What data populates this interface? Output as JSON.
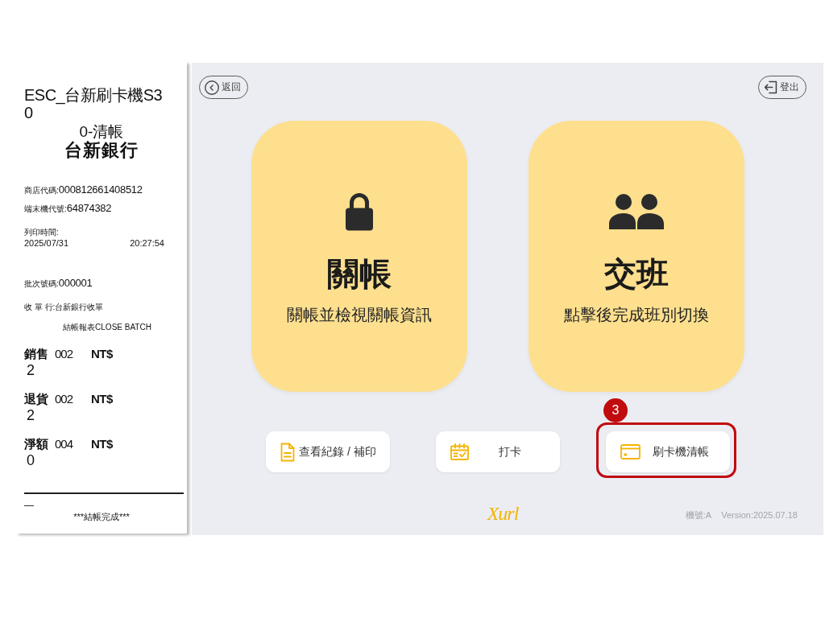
{
  "receipt": {
    "lines": [
      {
        "kind": "heading",
        "text": "ESC_台新刷卡機S3"
      },
      {
        "kind": "heading",
        "text": "0"
      },
      {
        "kind": "center",
        "text": "0-清帳"
      },
      {
        "kind": "bank",
        "text": "台新銀行"
      },
      {
        "kind": "field",
        "label": "商店代碼:",
        "value": "000812661408512"
      },
      {
        "kind": "field",
        "label": "端末機代號:",
        "value": "64874382"
      },
      {
        "kind": "note",
        "text": "列印時間:"
      },
      {
        "kind": "split",
        "left": "2025/07/31",
        "right": "20:27:54"
      },
      {
        "kind": "field",
        "label": "批次號碼:",
        "value": "000001"
      },
      {
        "kind": "note",
        "text": "收 單 行:台新銀行收單"
      },
      {
        "kind": "caption",
        "text": "結帳報表CLOSE BATCH"
      },
      {
        "kind": "total",
        "label": "銷售",
        "count": "002",
        "currency": "NT$",
        "amount": "2"
      },
      {
        "kind": "total",
        "label": "退貨",
        "count": "002",
        "currency": "NT$",
        "amount": "2"
      },
      {
        "kind": "total",
        "label": "淨額",
        "count": "004",
        "currency": "NT$",
        "amount": "0"
      },
      {
        "kind": "rule"
      },
      {
        "kind": "dash",
        "text": "—"
      },
      {
        "kind": "closing",
        "text": "***結帳完成***"
      }
    ]
  },
  "toolbar": {
    "back": {
      "label": "返回"
    },
    "logout": {
      "label": "登出"
    }
  },
  "cards": [
    {
      "kind": "lock",
      "title": "關帳",
      "subtitle": "關帳並檢視關帳資訊"
    },
    {
      "kind": "people",
      "title": "交班",
      "subtitle": "點擊後完成班別切換"
    }
  ],
  "actions": [
    {
      "kind": "document",
      "label": "查看紀錄 / 補印",
      "highlighted": false
    },
    {
      "kind": "calendar",
      "label": "打卡",
      "highlighted": false
    },
    {
      "kind": "card",
      "label": "刷卡機清帳",
      "highlighted": true,
      "badge": "3"
    }
  ],
  "footer": {
    "logo": "Xurl",
    "machine": "機號:A",
    "version": "Version:2025.07.18"
  }
}
